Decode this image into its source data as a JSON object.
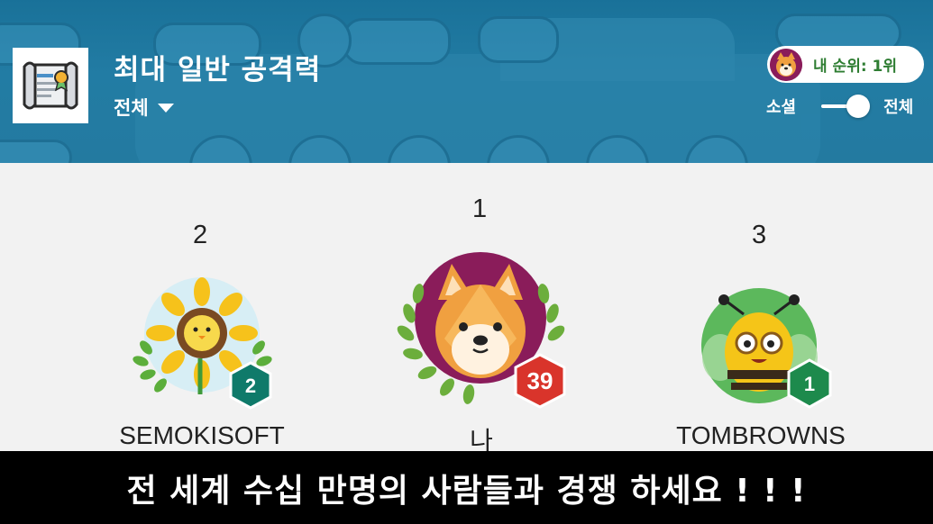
{
  "header": {
    "title": "최대 일반 공격력",
    "filter_label": "전체",
    "my_rank": "내 순위: 1위",
    "toggle_left": "소셜",
    "toggle_right": "전체"
  },
  "podium": [
    {
      "rank": "2",
      "name": "SEMOKISOFT",
      "level": "2",
      "avatar": "sunflower-avatar",
      "badge_color": "#0f7a6a"
    },
    {
      "rank": "1",
      "name": "나",
      "level": "39",
      "avatar": "shiba-dog-avatar",
      "badge_color": "#d9342b"
    },
    {
      "rank": "3",
      "name": "TOMBROWNS",
      "level": "1",
      "avatar": "bee-avatar",
      "badge_color": "#1d8a4c"
    }
  ],
  "banner": {
    "text": "전 세계 수십 만명의 사람들과 경쟁 하세요 ! ! !"
  }
}
